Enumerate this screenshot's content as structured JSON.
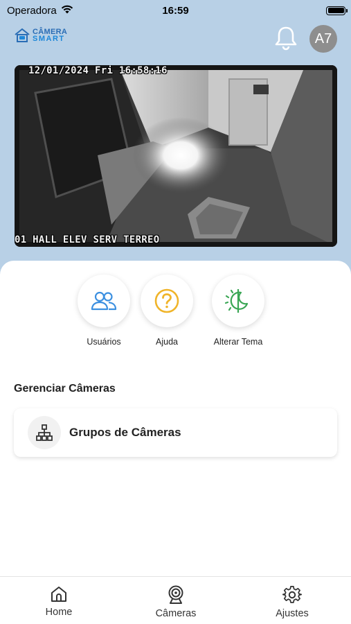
{
  "status_bar": {
    "carrier": "Operadora",
    "time": "16:59"
  },
  "header": {
    "logo_line1": "CÂMERA",
    "logo_line2": "SMART",
    "avatar_initials": "A7"
  },
  "camera_feed": {
    "timestamp": "12/01/2024 Fri 16:58:16",
    "camera_name": "01 HALL ELEV SERV TERREO"
  },
  "quick_actions": [
    {
      "label": "Usuários",
      "icon": "users-icon",
      "color": "#3b8fe0"
    },
    {
      "label": "Ajuda",
      "icon": "help-icon",
      "color": "#f0b429"
    },
    {
      "label": "Alterar Tema",
      "icon": "theme-icon",
      "color": "#3aa655"
    }
  ],
  "manage_section": {
    "title": "Gerenciar Câmeras",
    "items": [
      {
        "label": "Grupos de Câmeras",
        "icon": "hierarchy-icon"
      }
    ]
  },
  "tab_bar": {
    "tabs": [
      {
        "label": "Home",
        "icon": "home-icon"
      },
      {
        "label": "Câmeras",
        "icon": "webcam-icon"
      },
      {
        "label": "Ajustes",
        "icon": "gear-icon"
      }
    ]
  },
  "colors": {
    "header_background": "#b8d0e6",
    "brand_blue": "#2a6db5"
  }
}
